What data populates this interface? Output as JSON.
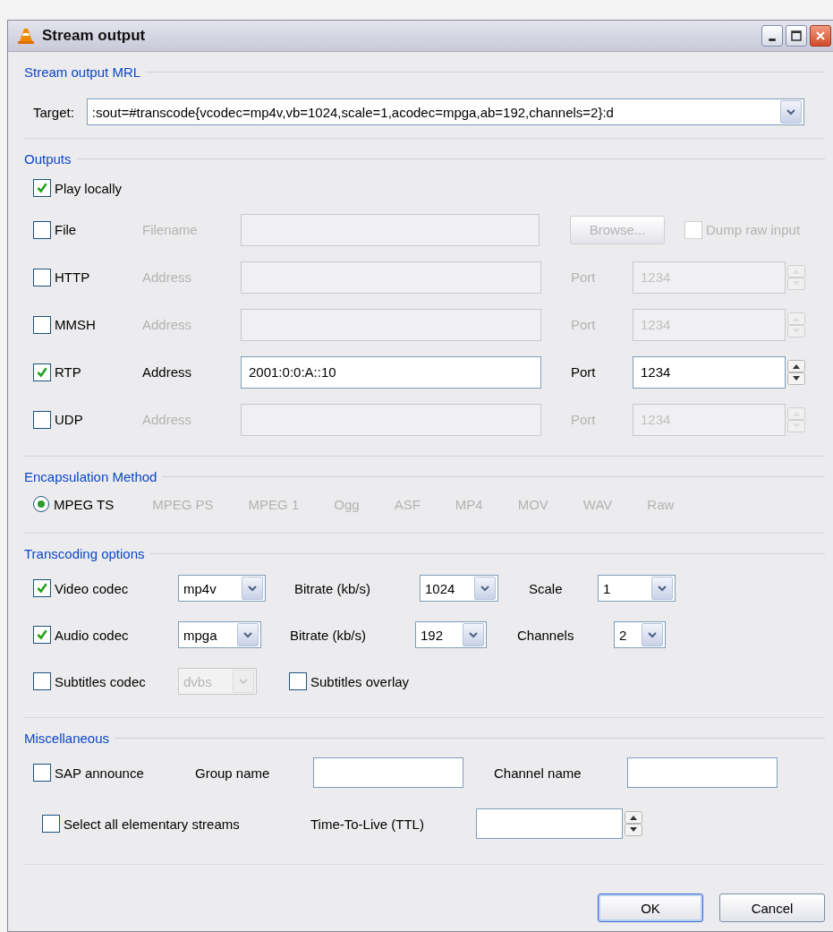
{
  "window": {
    "title": "Stream output"
  },
  "mrl": {
    "legend": "Stream output MRL",
    "target_label": "Target:",
    "target_value": ":sout=#transcode{vcodec=mp4v,vb=1024,scale=1,acodec=mpga,ab=192,channels=2}:d"
  },
  "outputs": {
    "legend": "Outputs",
    "play_locally": {
      "label": "Play locally",
      "checked": true
    },
    "file": {
      "label": "File",
      "checked": false,
      "field_label": "Filename",
      "button": "Browse...",
      "dump_label": "Dump raw input",
      "dump_checked": false
    },
    "rows": [
      {
        "label": "HTTP",
        "checked": false,
        "address_label": "Address",
        "port_label": "Port",
        "port": "1234"
      },
      {
        "label": "MMSH",
        "checked": false,
        "address_label": "Address",
        "port_label": "Port",
        "port": "1234"
      },
      {
        "label": "RTP",
        "checked": true,
        "address_label": "Address",
        "address": "2001:0:0:A::10",
        "port_label": "Port",
        "port": "1234"
      },
      {
        "label": "UDP",
        "checked": false,
        "address_label": "Address",
        "port_label": "Port",
        "port": "1234"
      }
    ]
  },
  "encapsulation": {
    "legend": "Encapsulation Method",
    "options": [
      {
        "label": "MPEG TS",
        "selected": true,
        "disabled": false
      },
      {
        "label": "MPEG PS",
        "selected": false,
        "disabled": true
      },
      {
        "label": "MPEG 1",
        "selected": false,
        "disabled": true
      },
      {
        "label": "Ogg",
        "selected": false,
        "disabled": true
      },
      {
        "label": "ASF",
        "selected": false,
        "disabled": true
      },
      {
        "label": "MP4",
        "selected": false,
        "disabled": true
      },
      {
        "label": "MOV",
        "selected": false,
        "disabled": true
      },
      {
        "label": "WAV",
        "selected": false,
        "disabled": true
      },
      {
        "label": "Raw",
        "selected": false,
        "disabled": true
      }
    ]
  },
  "transcoding": {
    "legend": "Transcoding options",
    "rows": [
      {
        "label": "Video codec",
        "checked": true,
        "codec": "mp4v",
        "bitrate_label": "Bitrate (kb/s)",
        "bitrate": "1024",
        "extra_label": "Scale",
        "extra_value": "1"
      },
      {
        "label": "Audio codec",
        "checked": true,
        "codec": "mpga",
        "bitrate_label": "Bitrate (kb/s)",
        "bitrate": "192",
        "extra_label": "Channels",
        "extra_value": "2"
      }
    ],
    "subtitles": {
      "label": "Subtitles codec",
      "checked": false,
      "codec": "dvbs",
      "overlay_label": "Subtitles overlay",
      "overlay_checked": false
    }
  },
  "misc": {
    "legend": "Miscellaneous",
    "sap": {
      "label": "SAP announce",
      "checked": false
    },
    "group_label": "Group name",
    "channel_label": "Channel name",
    "select_all": {
      "label": "Select all elementary streams",
      "checked": false
    },
    "ttl_label": "Time-To-Live (TTL)"
  },
  "buttons": [
    "OK",
    "Cancel"
  ]
}
